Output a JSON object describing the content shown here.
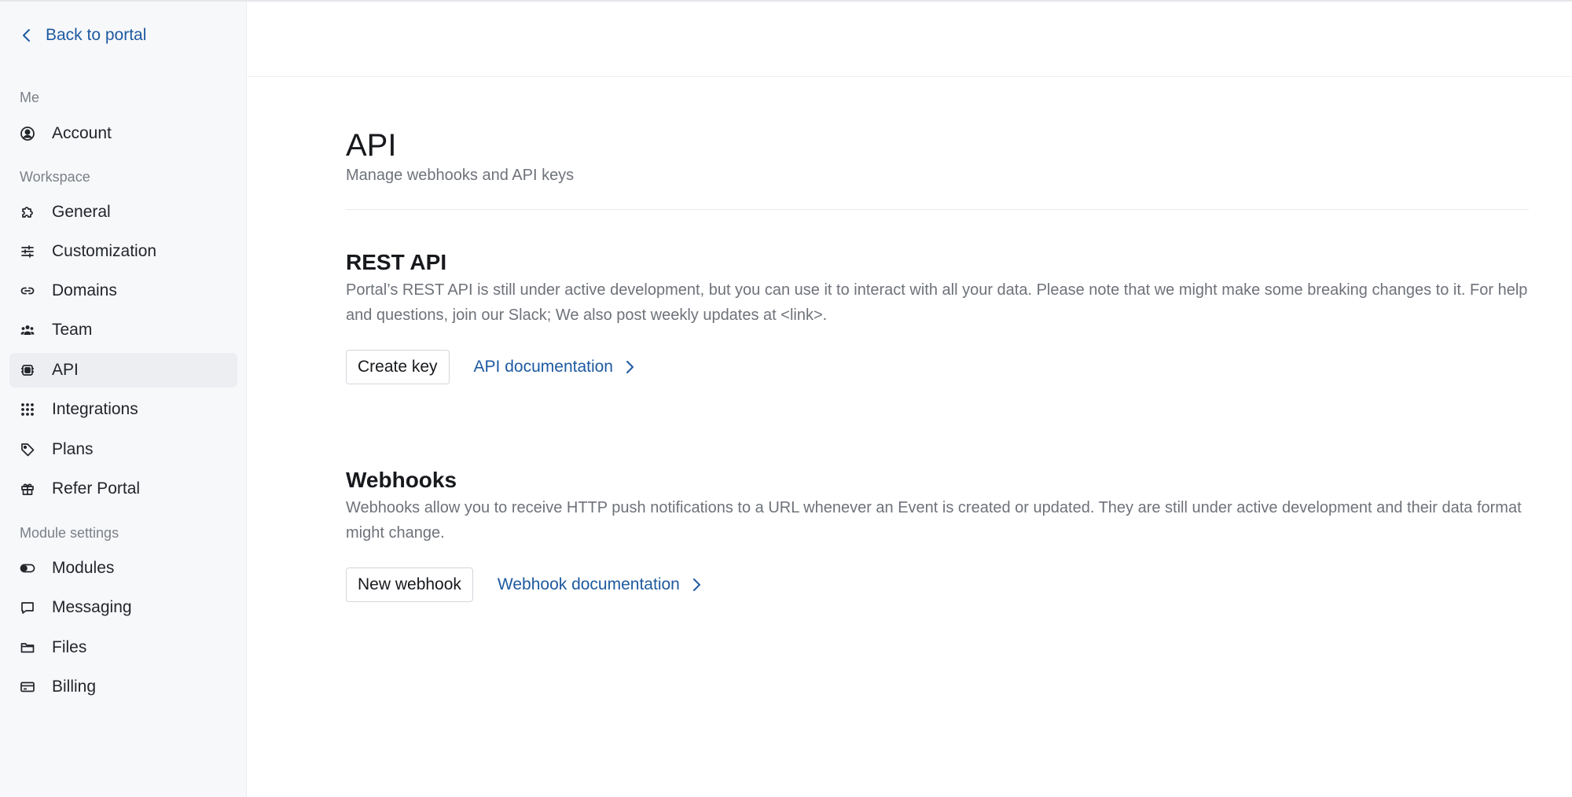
{
  "sidebar": {
    "back_label": "Back to portal",
    "sections": {
      "me": "Me",
      "workspace": "Workspace",
      "module_settings": "Module settings"
    },
    "items": {
      "account": "Account",
      "general": "General",
      "customization": "Customization",
      "domains": "Domains",
      "team": "Team",
      "api": "API",
      "integrations": "Integrations",
      "plans": "Plans",
      "refer": "Refer Portal",
      "modules": "Modules",
      "messaging": "Messaging",
      "files": "Files",
      "billing": "Billing"
    },
    "active_item": "API"
  },
  "page": {
    "title": "API",
    "subtitle": "Manage webhooks and API keys"
  },
  "rest_api": {
    "title": "REST API",
    "description": "Portal’s REST API is still under active development, but you can use it to interact with all your data. Please note that we might make some breaking changes to it. For help and questions, join our Slack; We also post weekly updates at <link>.",
    "button_label": "Create key",
    "doc_link_label": "API documentation"
  },
  "webhooks": {
    "title": "Webhooks",
    "description": "Webhooks allow you to receive HTTP push notifications to a URL whenever an Event is created or updated. They are still under active development and their data format might change.",
    "button_label": "New webhook",
    "doc_link_label": "Webhook documentation"
  },
  "colors": {
    "accent": "#1e5aa0",
    "sidebar_bg": "#f7f8fa",
    "active_item_bg": "#eceef2",
    "muted_text": "#6e7279"
  }
}
